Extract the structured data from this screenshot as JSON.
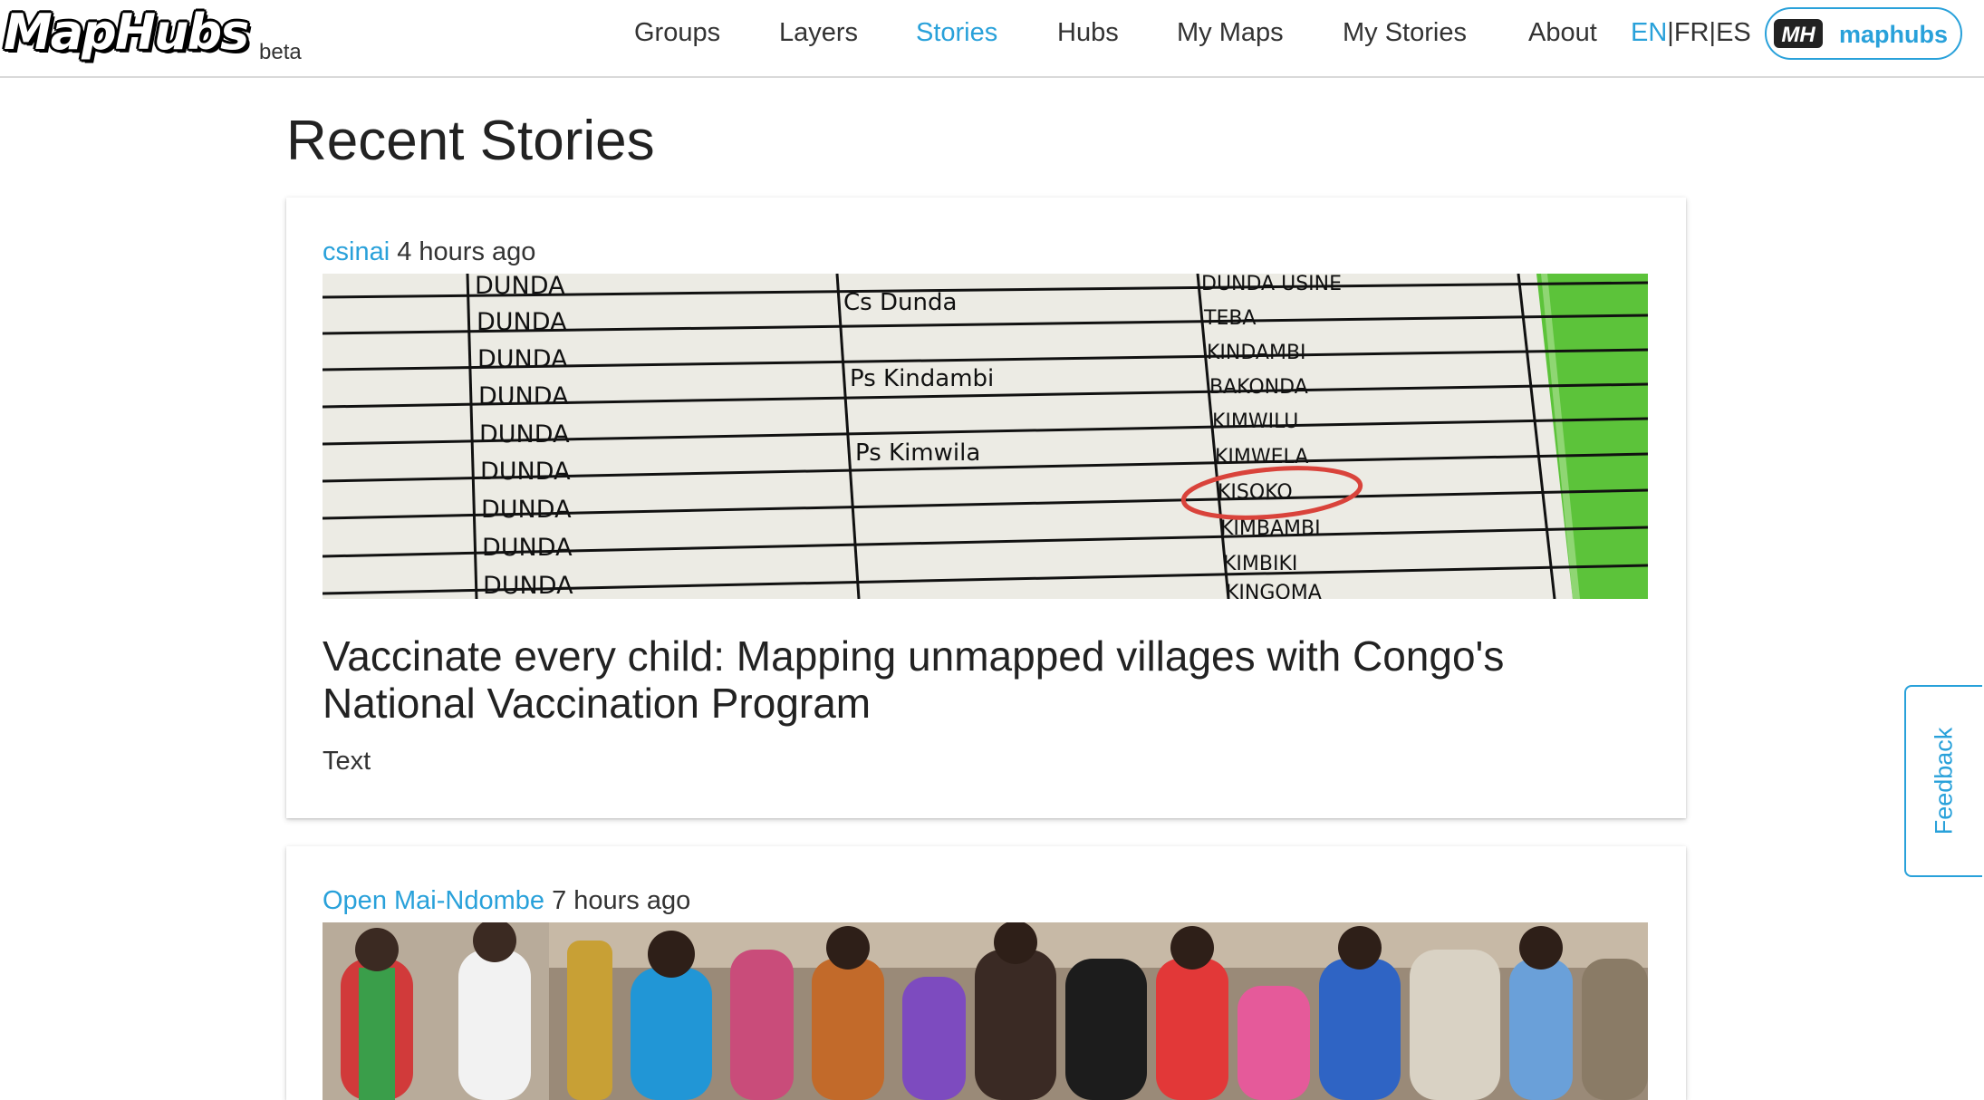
{
  "brand": {
    "logo_text": "MapHubs",
    "badge": "beta"
  },
  "nav": {
    "links": [
      {
        "label": "Groups"
      },
      {
        "label": "Layers"
      },
      {
        "label": "Stories"
      },
      {
        "label": "Hubs"
      },
      {
        "label": "My Maps"
      },
      {
        "label": "My Stories"
      },
      {
        "label": "About"
      }
    ],
    "active": "Stories",
    "languages": [
      "EN",
      "FR",
      "ES"
    ],
    "language_separator": "|",
    "active_language": "EN",
    "user": {
      "badge": "MH",
      "name": "maphubs"
    }
  },
  "page": {
    "title": "Recent Stories"
  },
  "stories": [
    {
      "author": "csinai",
      "time": "4 hours ago",
      "title": "Vaccinate every child: Mapping unmapped villages with Congo's National Vaccination Program",
      "tag": "Text",
      "image": {
        "col1": [
          "DUNDA",
          "DUNDA",
          "DUNDA",
          "DUNDA",
          "DUNDA",
          "DUNDA",
          "DUNDA",
          "DUNDA",
          "DUNDA"
        ],
        "col2": [
          "Cs Dunda",
          "Ps Kindambi",
          "Ps Kimwila"
        ],
        "col3": [
          "DUNDA USINE",
          "TEBA",
          "KINDAMBI",
          "BAKONDA",
          "KIMWILU",
          "KIMWELA",
          "KISOKO",
          "KIMBAMBI",
          "KIMBIKI",
          "KINGOMA"
        ],
        "highlight": "KISOKO"
      }
    },
    {
      "author": "Open Mai-Ndombe",
      "time": "7 hours ago"
    }
  ],
  "feedback": {
    "label": "Feedback"
  },
  "colors": {
    "accent": "#29a1da",
    "text": "#333333",
    "highlight_green": "#5cc33a",
    "circle_red": "#d9433b"
  }
}
